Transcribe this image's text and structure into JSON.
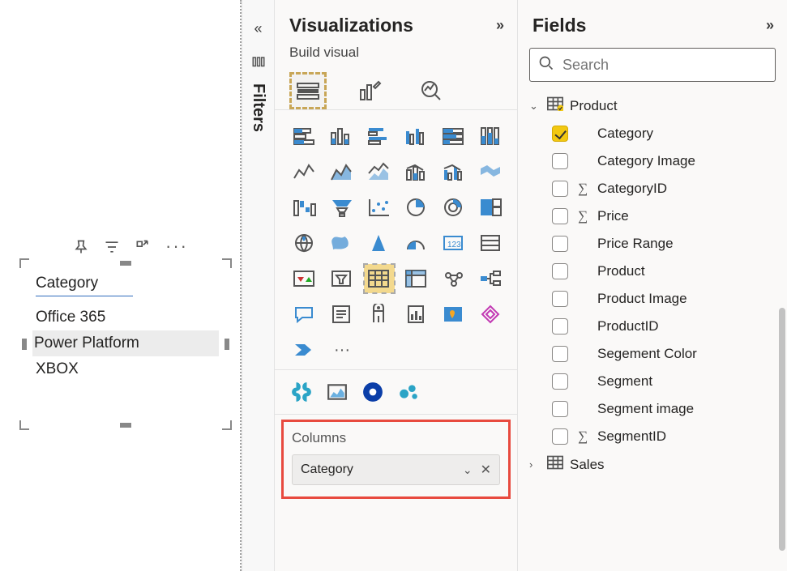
{
  "canvas": {
    "visual_header": "Category",
    "rows": [
      "Office 365",
      "Power Platform",
      "XBOX"
    ],
    "selected_index": 1
  },
  "filters": {
    "label": "Filters"
  },
  "visualizations": {
    "title": "Visualizations",
    "subtitle": "Build visual",
    "columns_label": "Columns",
    "column_field": "Category"
  },
  "fields": {
    "title": "Fields",
    "search_placeholder": "Search",
    "tables": [
      {
        "name": "Product",
        "expanded": true,
        "has_selected": true,
        "columns": [
          {
            "name": "Category",
            "checked": true,
            "sigma": false
          },
          {
            "name": "Category Image",
            "checked": false,
            "sigma": false
          },
          {
            "name": "CategoryID",
            "checked": false,
            "sigma": true
          },
          {
            "name": "Price",
            "checked": false,
            "sigma": true
          },
          {
            "name": "Price Range",
            "checked": false,
            "sigma": false
          },
          {
            "name": "Product",
            "checked": false,
            "sigma": false
          },
          {
            "name": "Product Image",
            "checked": false,
            "sigma": false
          },
          {
            "name": "ProductID",
            "checked": false,
            "sigma": false
          },
          {
            "name": "Segement Color",
            "checked": false,
            "sigma": false
          },
          {
            "name": "Segment",
            "checked": false,
            "sigma": false
          },
          {
            "name": "Segment image",
            "checked": false,
            "sigma": false
          },
          {
            "name": "SegmentID",
            "checked": false,
            "sigma": true
          }
        ]
      },
      {
        "name": "Sales",
        "expanded": false,
        "has_selected": false,
        "columns": []
      }
    ]
  }
}
